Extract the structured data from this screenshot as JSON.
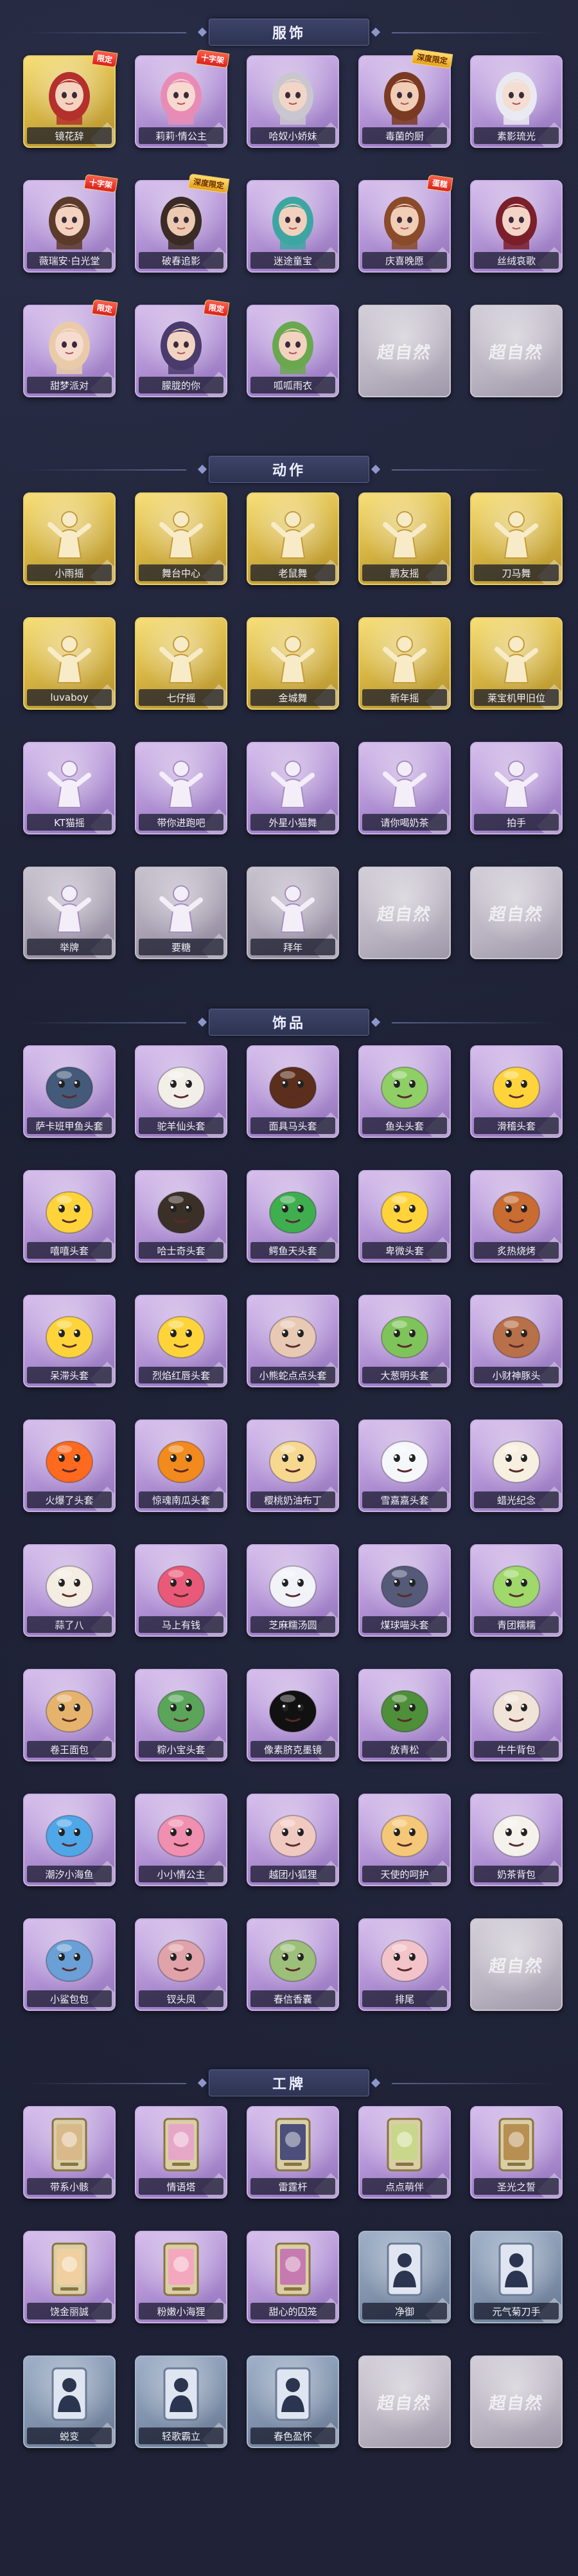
{
  "sections": [
    {
      "title": "服饰",
      "items": [
        {
          "label": "镜花辞",
          "rarity": "gold",
          "badge": "限定",
          "icon": "character-red-hood-icon",
          "hair": "#b4302c",
          "face": "#f4d3bf"
        },
        {
          "label": "莉莉·情公主",
          "rarity": "purple",
          "badge": "十字架",
          "icon": "character-pink-hair-icon",
          "hair": "#e88cb6",
          "face": "#f7d9cf"
        },
        {
          "label": "哈奴小娇妹",
          "rarity": "purple",
          "badge": "",
          "icon": "character-silver-hair-icon",
          "hair": "#c9c6cf",
          "face": "#f1d6c8"
        },
        {
          "label": "毒菌的厨",
          "rarity": "purple",
          "badge": "深度限定",
          "icon": "character-mushroom-hat-icon",
          "hair": "#7a3a22",
          "face": "#f0cdb4"
        },
        {
          "label": "素影琉光",
          "rarity": "purple",
          "badge": "",
          "icon": "character-white-hair-icon",
          "hair": "#e9eaf1",
          "face": "#f4ddd3"
        },
        {
          "label": "薇瑞安·白光堂",
          "rarity": "purple",
          "badge": "十字架",
          "icon": "character-brown-hair-icon",
          "hair": "#5c3b2a",
          "face": "#f3d3c0"
        },
        {
          "label": "破春追影",
          "rarity": "purple",
          "badge": "深度限定",
          "icon": "character-dark-hair-icon",
          "hair": "#3a2b25",
          "face": "#ecc9b1"
        },
        {
          "label": "迷途童宝",
          "rarity": "purple",
          "badge": "",
          "icon": "character-teal-hair-icon",
          "hair": "#3ea6a2",
          "face": "#f1d1bd"
        },
        {
          "label": "庆喜晚愿",
          "rarity": "purple",
          "badge": "蛋糕",
          "icon": "character-cake-icon",
          "hair": "#8a4b2a",
          "face": "#f0cdb5"
        },
        {
          "label": "丝绒哀歌",
          "rarity": "purple",
          "badge": "",
          "icon": "character-red-hair-icon",
          "hair": "#7b1f2b",
          "face": "#f3d5c8"
        },
        {
          "label": "甜梦派对",
          "rarity": "purple",
          "badge": "限定",
          "icon": "character-party-icon",
          "hair": "#e9cba9",
          "face": "#f6dccf"
        },
        {
          "label": "朦胧的你",
          "rarity": "purple",
          "badge": "限定",
          "icon": "character-hat-icon",
          "hair": "#493b6b",
          "face": "#f1d3c3"
        },
        {
          "label": "呱呱雨衣",
          "rarity": "purple",
          "badge": "",
          "icon": "character-frog-raincoat-icon",
          "hair": "#6aa84f",
          "face": "#f2d3bf"
        },
        {
          "label": "",
          "rarity": "empty",
          "badge": "",
          "icon": "placeholder-logo-icon",
          "hair": "",
          "face": ""
        },
        {
          "label": "",
          "rarity": "empty",
          "badge": "",
          "icon": "placeholder-logo-icon",
          "hair": "",
          "face": ""
        }
      ]
    },
    {
      "title": "动作",
      "items": [
        {
          "label": "小雨摇",
          "rarity": "gold",
          "badge": "",
          "icon": "action-figure-icon"
        },
        {
          "label": "舞台中心",
          "rarity": "gold",
          "badge": "",
          "icon": "action-figure-icon"
        },
        {
          "label": "老鼠舞",
          "rarity": "gold",
          "badge": "",
          "icon": "action-figure-icon"
        },
        {
          "label": "鹏友摇",
          "rarity": "gold",
          "badge": "",
          "icon": "action-figure-icon"
        },
        {
          "label": "刀马舞",
          "rarity": "gold",
          "badge": "",
          "icon": "action-figure-icon"
        },
        {
          "label": "luvaboy",
          "rarity": "gold",
          "badge": "",
          "icon": "action-figure-icon"
        },
        {
          "label": "七仔摇",
          "rarity": "gold",
          "badge": "",
          "icon": "action-figure-icon"
        },
        {
          "label": "金城舞",
          "rarity": "gold",
          "badge": "",
          "icon": "action-figure-icon"
        },
        {
          "label": "新年摇",
          "rarity": "gold",
          "badge": "",
          "icon": "action-figure-icon"
        },
        {
          "label": "莱宝机甲旧位",
          "rarity": "gold",
          "badge": "",
          "icon": "action-figure-icon"
        },
        {
          "label": "KT猫摇",
          "rarity": "purple",
          "badge": "",
          "icon": "action-figure-icon"
        },
        {
          "label": "带你进跑吧",
          "rarity": "purple",
          "badge": "",
          "icon": "action-figure-icon"
        },
        {
          "label": "外星小猫舞",
          "rarity": "purple",
          "badge": "",
          "icon": "action-figure-icon"
        },
        {
          "label": "请你喝奶茶",
          "rarity": "purple",
          "badge": "",
          "icon": "action-figure-icon"
        },
        {
          "label": "拍手",
          "rarity": "purple",
          "badge": "",
          "icon": "action-figure-icon"
        },
        {
          "label": "举牌",
          "rarity": "gray",
          "badge": "",
          "icon": "action-figure-icon"
        },
        {
          "label": "要糖",
          "rarity": "gray",
          "badge": "",
          "icon": "action-figure-icon"
        },
        {
          "label": "拜年",
          "rarity": "gray",
          "badge": "",
          "icon": "action-figure-icon"
        },
        {
          "label": "",
          "rarity": "empty",
          "badge": "",
          "icon": "placeholder-logo-icon"
        },
        {
          "label": "",
          "rarity": "empty",
          "badge": "",
          "icon": "placeholder-logo-icon"
        }
      ]
    },
    {
      "title": "饰品",
      "items": [
        {
          "label": "萨卡班甲鱼头套",
          "rarity": "purple",
          "badge": "",
          "icon": "fish-head-icon",
          "color": "#445a7a"
        },
        {
          "label": "驼羊仙头套",
          "rarity": "purple",
          "badge": "",
          "icon": "panda-head-icon",
          "color": "#f2efe9"
        },
        {
          "label": "面具马头套",
          "rarity": "purple",
          "badge": "",
          "icon": "horse-head-icon",
          "color": "#5b2f1c"
        },
        {
          "label": "鱼头头套",
          "rarity": "purple",
          "badge": "",
          "icon": "green-fish-head-icon",
          "color": "#8fcf66"
        },
        {
          "label": "滑稽头套",
          "rarity": "purple",
          "badge": "",
          "icon": "smiley-head-icon",
          "color": "#ffd43b"
        },
        {
          "label": "嘻嘻头套",
          "rarity": "purple",
          "badge": "",
          "icon": "grin-emoji-icon",
          "color": "#ffd43b"
        },
        {
          "label": "哈士奇头套",
          "rarity": "purple",
          "badge": "",
          "icon": "dog-head-icon",
          "color": "#3b3027"
        },
        {
          "label": "鳄鱼天头套",
          "rarity": "purple",
          "badge": "",
          "icon": "crocodile-head-icon",
          "color": "#3fae4f"
        },
        {
          "label": "卑微头套",
          "rarity": "purple",
          "badge": "",
          "icon": "sad-emoji-icon",
          "color": "#ffd43b"
        },
        {
          "label": "炙热烧烤",
          "rarity": "purple",
          "badge": "",
          "icon": "grill-head-icon",
          "color": "#c86c32"
        },
        {
          "label": "呆滞头套",
          "rarity": "purple",
          "badge": "",
          "icon": "blank-emoji-icon",
          "color": "#ffd43b"
        },
        {
          "label": "烈焰红唇头套",
          "rarity": "purple",
          "badge": "",
          "icon": "pikachu-head-icon",
          "color": "#ffd43b"
        },
        {
          "label": "小熊蛇点点头套",
          "rarity": "purple",
          "badge": "",
          "icon": "worm-head-icon",
          "color": "#e8c9b4"
        },
        {
          "label": "大葱明头套",
          "rarity": "purple",
          "badge": "",
          "icon": "leek-head-icon",
          "color": "#7fc45a"
        },
        {
          "label": "小财神豚头",
          "rarity": "purple",
          "badge": "",
          "icon": "pig-head-icon",
          "color": "#b87049"
        },
        {
          "label": "火爆了头套",
          "rarity": "purple",
          "badge": "",
          "icon": "fire-head-icon",
          "color": "#ff6a1f"
        },
        {
          "label": "惊魂南瓜头套",
          "rarity": "purple",
          "badge": "",
          "icon": "pumpkin-head-icon",
          "color": "#f28a1d"
        },
        {
          "label": "樱桃奶油布丁",
          "rarity": "purple",
          "badge": "",
          "icon": "pudding-head-icon",
          "color": "#f6d891"
        },
        {
          "label": "雪嘉嘉头套",
          "rarity": "purple",
          "badge": "",
          "icon": "snowman-head-icon",
          "color": "#f6f7fb"
        },
        {
          "label": "蜡光纪念",
          "rarity": "purple",
          "badge": "",
          "icon": "candle-head-icon",
          "color": "#f7efe0"
        },
        {
          "label": "蒜了八",
          "rarity": "purple",
          "badge": "",
          "icon": "garlic-head-icon",
          "color": "#f3ede2"
        },
        {
          "label": "马上有钱",
          "rarity": "purple",
          "badge": "",
          "icon": "horse-toy-icon",
          "color": "#e85a78"
        },
        {
          "label": "芝麻糯汤圆",
          "rarity": "purple",
          "badge": "",
          "icon": "dumpling-icon",
          "color": "#f1f3f9"
        },
        {
          "label": "煤球喵头套",
          "rarity": "purple",
          "badge": "",
          "icon": "cat-head-icon",
          "color": "#545a78"
        },
        {
          "label": "青团糯糯",
          "rarity": "purple",
          "badge": "",
          "icon": "green-dumpling-icon",
          "color": "#9fd86b"
        },
        {
          "label": "卷王面包",
          "rarity": "purple",
          "badge": "",
          "icon": "bread-head-icon",
          "color": "#e6b36d"
        },
        {
          "label": "粽小宝头套",
          "rarity": "purple",
          "badge": "",
          "icon": "zongzi-head-icon",
          "color": "#5aa55a"
        },
        {
          "label": "像素脐克墨镜",
          "rarity": "purple",
          "badge": "",
          "icon": "pixel-glasses-icon",
          "color": "#111111"
        },
        {
          "label": "放青松",
          "rarity": "purple",
          "badge": "",
          "icon": "bonsai-icon",
          "color": "#4e8f3a"
        },
        {
          "label": "牛牛背包",
          "rarity": "purple",
          "badge": "",
          "icon": "cow-backpack-icon",
          "color": "#f0e3d8"
        },
        {
          "label": "潮汐小海鱼",
          "rarity": "purple",
          "badge": "",
          "icon": "blue-cat-icon",
          "color": "#4fa7e8"
        },
        {
          "label": "小小情公主",
          "rarity": "purple",
          "badge": "",
          "icon": "princess-doll-icon",
          "color": "#f08fb0"
        },
        {
          "label": "越团小狐狸",
          "rarity": "purple",
          "badge": "",
          "icon": "fox-doll-icon",
          "color": "#f0c9c0"
        },
        {
          "label": "天使的呵护",
          "rarity": "purple",
          "badge": "",
          "icon": "angel-doll-icon",
          "color": "#f4c878"
        },
        {
          "label": "奶茶背包",
          "rarity": "purple",
          "badge": "",
          "icon": "milktea-backpack-icon",
          "color": "#f5f2ec"
        },
        {
          "label": "小鲨包包",
          "rarity": "purple",
          "badge": "",
          "icon": "shark-bag-icon",
          "color": "#6aa0d6"
        },
        {
          "label": "钗头凤",
          "rarity": "purple",
          "badge": "",
          "icon": "phoenix-doll-icon",
          "color": "#e0a3a9"
        },
        {
          "label": "春信香囊",
          "rarity": "purple",
          "badge": "",
          "icon": "sachet-icon",
          "color": "#9cbf79"
        },
        {
          "label": "排尾",
          "rarity": "purple",
          "badge": "",
          "icon": "tail-icon",
          "color": "#f2c3c9"
        },
        {
          "label": "",
          "rarity": "empty",
          "badge": "",
          "icon": "placeholder-logo-icon",
          "color": ""
        }
      ]
    },
    {
      "title": "工牌",
      "items": [
        {
          "label": "带系小骸",
          "rarity": "purple",
          "badge": "",
          "icon": "badge-card-icon",
          "color": "#d9b88a"
        },
        {
          "label": "情语塔",
          "rarity": "purple",
          "badge": "",
          "icon": "badge-card-icon",
          "color": "#e6a7c6"
        },
        {
          "label": "雷霆杆",
          "rarity": "purple",
          "badge": "",
          "icon": "badge-card-icon",
          "color": "#4b4f7a"
        },
        {
          "label": "点点萌伴",
          "rarity": "purple",
          "badge": "",
          "icon": "badge-card-icon",
          "color": "#c8d78b"
        },
        {
          "label": "圣光之誓",
          "rarity": "purple",
          "badge": "",
          "icon": "badge-card-icon",
          "color": "#b88f52"
        },
        {
          "label": "饶金丽誠",
          "rarity": "purple",
          "badge": "",
          "icon": "badge-card-icon",
          "color": "#f0cfa0"
        },
        {
          "label": "粉嫩小海狸",
          "rarity": "purple",
          "badge": "",
          "icon": "badge-card-icon",
          "color": "#f3a8bd"
        },
        {
          "label": "甜心的囚笼",
          "rarity": "purple",
          "badge": "",
          "icon": "badge-card-icon",
          "color": "#c67bb0"
        },
        {
          "label": "净御",
          "rarity": "bluegray",
          "badge": "",
          "icon": "badge-silhouette-icon",
          "color": "#2c3550"
        },
        {
          "label": "元气菊刀手",
          "rarity": "bluegray",
          "badge": "",
          "icon": "badge-silhouette-icon",
          "color": "#2c3550"
        },
        {
          "label": "蜕变",
          "rarity": "bluegray",
          "badge": "",
          "icon": "badge-silhouette-icon",
          "color": "#2c3550"
        },
        {
          "label": "轻歌霸立",
          "rarity": "bluegray",
          "badge": "",
          "icon": "badge-silhouette-icon",
          "color": "#2c3550"
        },
        {
          "label": "春色盈怀",
          "rarity": "bluegray",
          "badge": "",
          "icon": "badge-silhouette-icon",
          "color": "#2c3550"
        },
        {
          "label": "",
          "rarity": "empty",
          "badge": "",
          "icon": "placeholder-logo-icon",
          "color": ""
        },
        {
          "label": "",
          "rarity": "empty",
          "badge": "",
          "icon": "placeholder-logo-icon",
          "color": ""
        }
      ]
    }
  ],
  "placeholder_text": "超自然"
}
